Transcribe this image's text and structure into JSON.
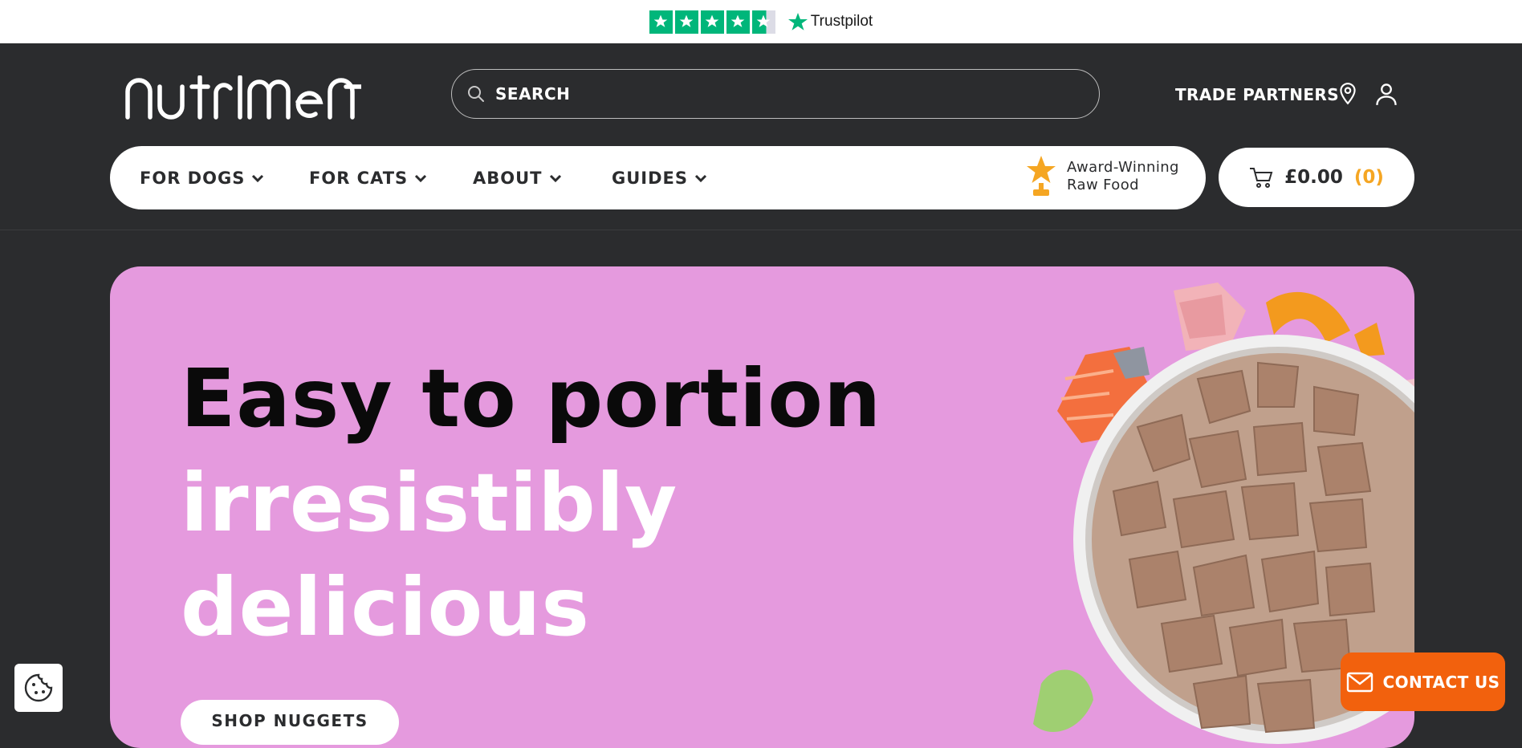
{
  "trustpilot": {
    "brand": "Trustpilot",
    "rating_stars": 4.5
  },
  "header": {
    "logo_text": "nutriment",
    "search_placeholder": "SEARCH",
    "trade_partners": "TRADE PARTNERS",
    "icons": {
      "store_locator": "map-pin-icon",
      "account": "user-icon"
    }
  },
  "nav": {
    "items": [
      {
        "label": "FOR DOGS"
      },
      {
        "label": "FOR CATS"
      },
      {
        "label": "ABOUT"
      },
      {
        "label": "GUIDES"
      }
    ],
    "award_line1": "Award-Winning",
    "award_line2": "Raw Food"
  },
  "cart": {
    "total": "£0.00",
    "count": "(0)"
  },
  "hero": {
    "line1": "Easy to portion",
    "line2": "irresistibly",
    "line3": "delicious",
    "cta": "SHOP NUGGETS"
  },
  "contact": {
    "label": "CONTACT US"
  },
  "colors": {
    "header_bg": "#2b2c2e",
    "hero_bg": "#e59ade",
    "accent_orange": "#f2610d",
    "cart_count": "#f5a623",
    "trustpilot_green": "#00b67a"
  }
}
